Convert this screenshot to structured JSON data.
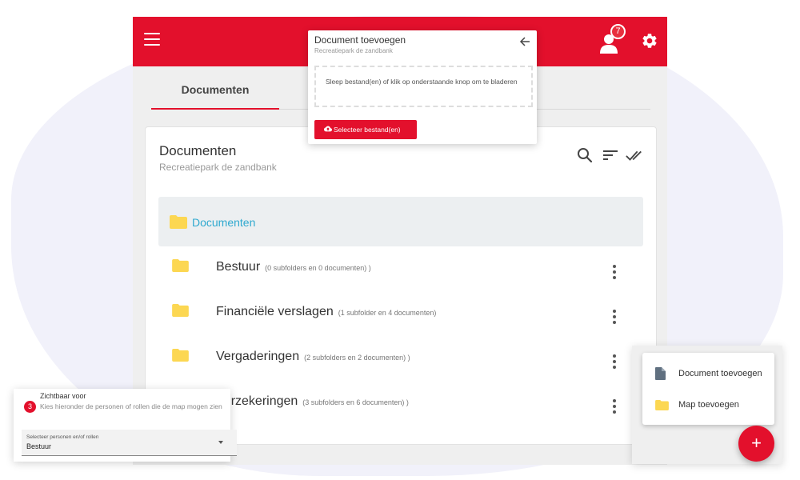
{
  "colors": {
    "brand": "#e3102c",
    "link": "#2fa9cf",
    "folder": "#fcd752"
  },
  "header": {
    "notification_count": "7"
  },
  "tabs": [
    {
      "label": "Documenten"
    }
  ],
  "card": {
    "title": "Documenten",
    "subtitle": "Recreatiepark de zandbank",
    "current_folder": "Documenten",
    "folders": [
      {
        "name": "Bestuur",
        "count": "(0 subfolders en 0 documenten) )"
      },
      {
        "name": "Financiële verslagen",
        "count": "(1 subfolder en 4 documenten)"
      },
      {
        "name": "Vergaderingen",
        "count": "(2 subfolders en 2 documenten) )"
      },
      {
        "name": "Verzekeringen",
        "count": "(3 subfolders en 6 documenten) )"
      }
    ]
  },
  "upload_dialog": {
    "title": "Document toevoegen",
    "subtitle": "Recreatiepark de zandbank",
    "dropzone_text": "Sleep bestand(en) of klik op onderstaande knop om te bladeren",
    "select_button": "Selecteer bestand(en)"
  },
  "visibility": {
    "title": "Zichtbaar voor",
    "step": "3",
    "description": "Kies hieronder de personen of rollen die de map mogen zien",
    "select_label": "Selecteer personen en/of rollen",
    "select_value": "Bestuur"
  },
  "fab_menu": {
    "items": [
      {
        "label": "Document toevoegen"
      },
      {
        "label": "Map toevoegen"
      }
    ],
    "fab_label": "+"
  }
}
